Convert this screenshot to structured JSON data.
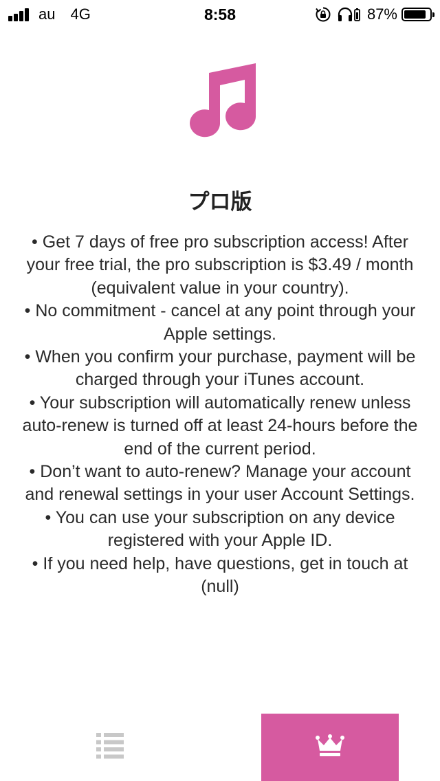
{
  "status_bar": {
    "carrier": "au",
    "network": "4G",
    "time": "8:58",
    "battery_percent": "87%",
    "battery_level": 0.87
  },
  "colors": {
    "accent": "#d65aa0",
    "tab_inactive": "#c8c8c8",
    "text": "#2a2a2a"
  },
  "hero": {
    "icon": "music-note-icon",
    "title": "プロ版"
  },
  "terms": [
    "• Get 7 days of free pro subscription access! After your free trial, the pro subscription is $3.49 / month (equivalent value in your country).",
    "• No commitment - cancel at any point through your Apple settings.",
    "• When you confirm your purchase, payment will be charged through your iTunes account.",
    "• Your subscription will automatically renew unless auto-renew is turned off at least 24-hours before the end of the current period.",
    "• Don’t want to auto-renew? Manage your account and renewal settings in your user Account Settings.",
    "• You can use your subscription on any device registered with your Apple ID.",
    "• If you need help, have questions, get in touch at (null)"
  ],
  "tabs": [
    {
      "icon": "list-icon",
      "selected": false
    },
    {
      "icon": "crown-icon",
      "selected": true
    }
  ]
}
